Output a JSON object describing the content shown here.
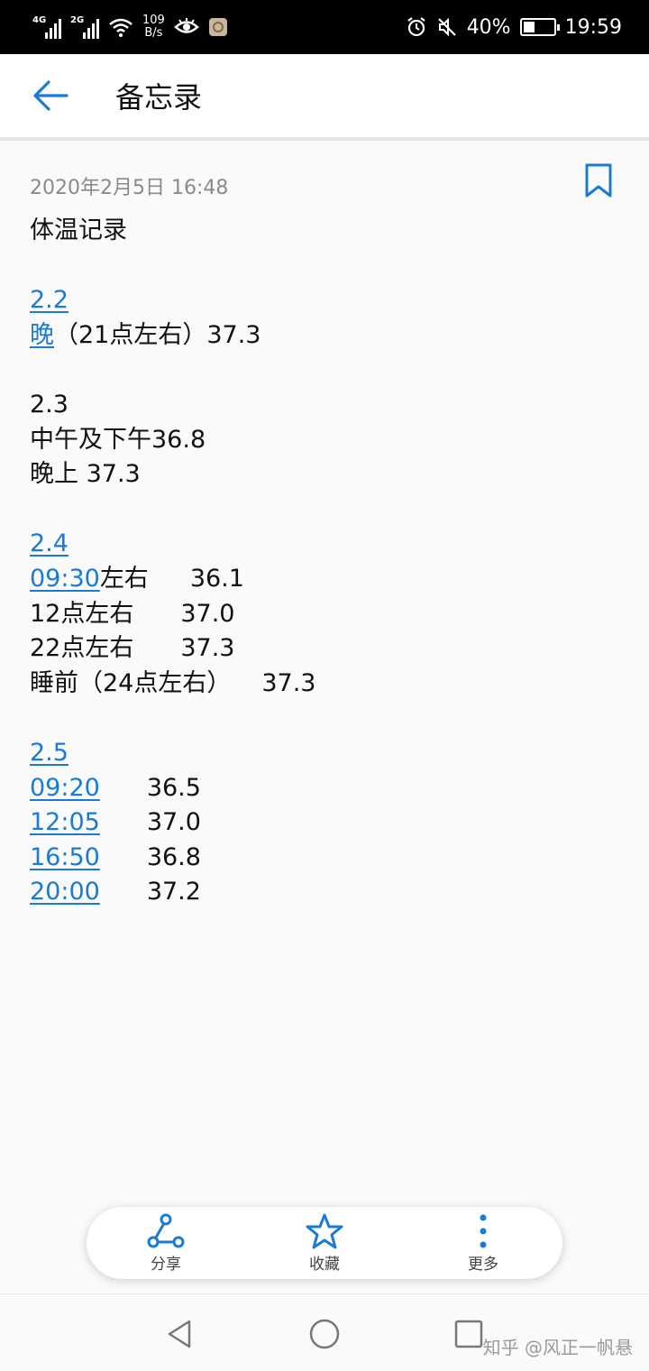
{
  "status_bar": {
    "net1": "4G",
    "net2": "2G",
    "speed_value": "109",
    "speed_unit": "B/s",
    "battery_text": "40%",
    "battery_level": 0.4,
    "time": "19:59"
  },
  "header": {
    "title": "备忘录"
  },
  "note": {
    "timestamp": "2020年2月5日 16:48",
    "title": "体温记录",
    "sections": [
      {
        "date": "2.2",
        "lines": [
          {
            "time": "晚",
            "rest": "（21点左右）37.3"
          }
        ]
      },
      {
        "date": "2.3",
        "lines": [
          {
            "time": "",
            "rest": "中午及下午36.8"
          },
          {
            "time": "",
            "rest": "晚上 37.3"
          }
        ]
      },
      {
        "date": "2.4",
        "lines": [
          {
            "time": "09:30",
            "label": "左右",
            "temp": "36.1"
          },
          {
            "time": "",
            "label": "12点左右",
            "temp": "37.0"
          },
          {
            "time": "",
            "label": "22点左右",
            "temp": "37.3"
          },
          {
            "time": "",
            "label": "睡前（24点左右）",
            "temp": "37.3"
          }
        ]
      },
      {
        "date": "2.5",
        "lines": [
          {
            "time": "09:20",
            "temp": "36.5"
          },
          {
            "time": "12:05",
            "temp": "37.0"
          },
          {
            "time": "16:50",
            "temp": "36.8"
          },
          {
            "time": "20:00",
            "temp": "37.2"
          }
        ]
      }
    ]
  },
  "toolbar": {
    "share_label": "分享",
    "favorite_label": "收藏",
    "more_label": "更多"
  },
  "watermark": "知乎 @风正一帆悬",
  "colors": {
    "accent": "#1a7ad6",
    "status_bar_bg": "#000000",
    "meta_text": "#8a8a8a"
  }
}
